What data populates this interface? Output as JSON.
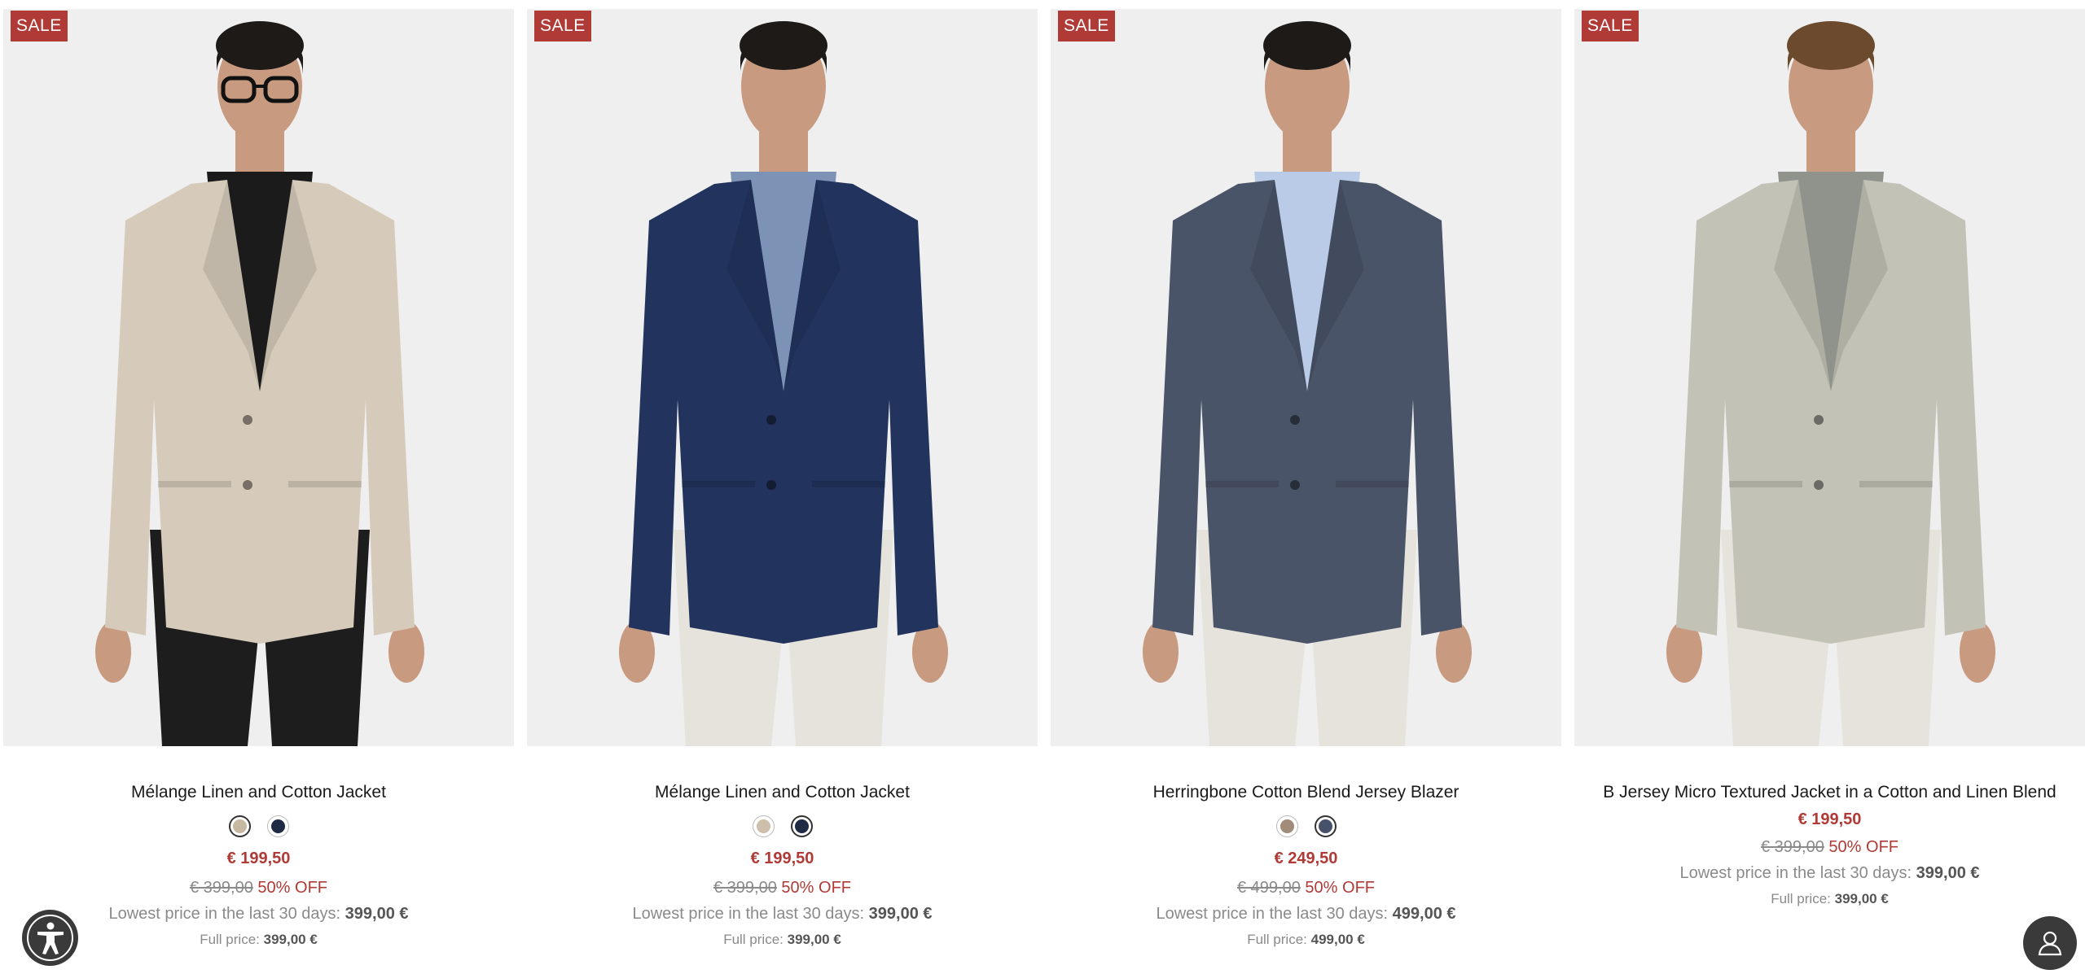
{
  "products": [
    {
      "badge": "SALE",
      "name": "Mélange Linen and Cotton Jacket",
      "swatches": [
        {
          "color": "#c7b8a2",
          "active": true
        },
        {
          "color": "#1f2a44",
          "active": false
        }
      ],
      "price": "€ 199,50",
      "old_price": "€ 399,00",
      "discount": "50% OFF",
      "lowest_label": "Lowest price in the last 30 days:",
      "lowest_value": "399,00 €",
      "full_label": "Full price:",
      "full_value": "399,00 €",
      "jacket_color": "#d6cbbb",
      "shirt_color": "#1b1b1b",
      "pants_color": "#1d1d1d"
    },
    {
      "badge": "SALE",
      "name": "Mélange Linen and Cotton Jacket",
      "swatches": [
        {
          "color": "#cdbfac",
          "active": false
        },
        {
          "color": "#1f2a44",
          "active": true
        }
      ],
      "price": "€ 199,50",
      "old_price": "€ 399,00",
      "discount": "50% OFF",
      "lowest_label": "Lowest price in the last 30 days:",
      "lowest_value": "399,00 €",
      "full_label": "Full price:",
      "full_value": "399,00 €",
      "jacket_color": "#22345e",
      "shirt_color": "#7d93b6",
      "pants_color": "#e6e3dc"
    },
    {
      "badge": "SALE",
      "name": "Herringbone Cotton Blend Jersey Blazer",
      "swatches": [
        {
          "color": "#a08c78",
          "active": false
        },
        {
          "color": "#47526a",
          "active": true
        }
      ],
      "price": "€ 249,50",
      "old_price": "€ 499,00",
      "discount": "50% OFF",
      "lowest_label": "Lowest price in the last 30 days:",
      "lowest_value": "499,00 €",
      "full_label": "Full price:",
      "full_value": "499,00 €",
      "jacket_color": "#4a5468",
      "shirt_color": "#b9cbe6",
      "pants_color": "#e6e3dc"
    },
    {
      "badge": "SALE",
      "name": "B Jersey Micro Textured Jacket in a Cotton and Linen Blend",
      "swatches": [],
      "price": "€ 199,50",
      "old_price": "€ 399,00",
      "discount": "50% OFF",
      "lowest_label": "Lowest price in the last 30 days:",
      "lowest_value": "399,00 €",
      "full_label": "Full price:",
      "full_value": "399,00 €",
      "jacket_color": "#c3c2b6",
      "shirt_color": "#8f938c",
      "pants_color": "#e6e3dc"
    }
  ],
  "widgets": {
    "accessibility_icon": "accessibility-icon",
    "chat_icon": "user-icon"
  }
}
